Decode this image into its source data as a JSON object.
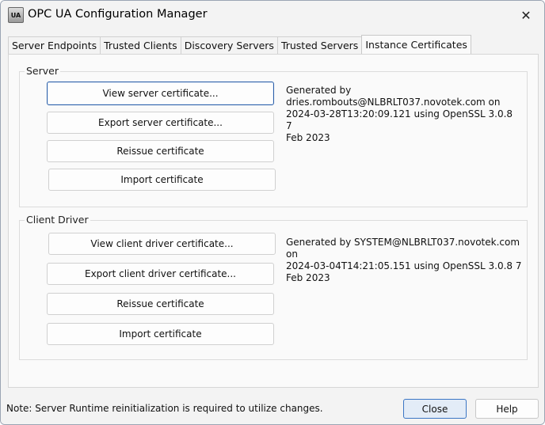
{
  "window": {
    "title": "OPC UA Configuration Manager",
    "icon_text": "UA"
  },
  "tabs": [
    {
      "label": "Server Endpoints"
    },
    {
      "label": "Trusted Clients"
    },
    {
      "label": "Discovery Servers"
    },
    {
      "label": "Trusted Servers"
    },
    {
      "label": "Instance Certificates",
      "active": true
    }
  ],
  "server": {
    "group_label": "Server",
    "view_label": "View server certificate...",
    "export_label": "Export server certificate...",
    "reissue_label": "Reissue certificate",
    "import_label": "Import certificate",
    "info_lines": [
      "Generated by",
      "dries.rombouts@NLBRLT037.novotek.com on",
      "2024-03-28T13:20:09.121 using OpenSSL 3.0.8 7",
      "Feb 2023"
    ]
  },
  "client_driver": {
    "group_label": "Client Driver",
    "view_label": "View client driver certificate...",
    "export_label": "Export client driver certificate...",
    "reissue_label": "Reissue certificate",
    "import_label": "Import certificate",
    "info_lines": [
      "Generated by SYSTEM@NLBRLT037.novotek.com on",
      "2024-03-04T14:21:05.151 using OpenSSL 3.0.8 7",
      "Feb 2023"
    ]
  },
  "footer": {
    "note": "Note: Server Runtime reinitialization is required to utilize changes.",
    "close_label": "Close",
    "help_label": "Help"
  }
}
